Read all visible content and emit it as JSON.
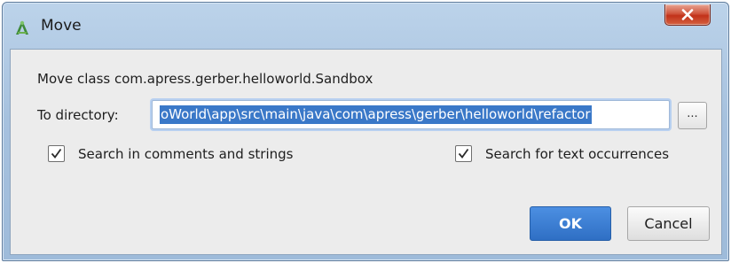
{
  "window": {
    "title": "Move",
    "icon": "android-studio-icon",
    "close_icon": "close-icon"
  },
  "dialog": {
    "move_label": "Move class com.apress.gerber.helloworld.Sandbox",
    "directory_label": "To directory:",
    "directory_value": "oWorld\\app\\src\\main\\java\\com\\apress\\gerber\\helloworld\\refactor",
    "browse_label": "...",
    "checkboxes": [
      {
        "label": "Search in comments and strings",
        "checked": true
      },
      {
        "label": "Search for text occurrences",
        "checked": true
      }
    ],
    "ok_label": "OK",
    "cancel_label": "Cancel"
  },
  "colors": {
    "accent": "#3a78c8",
    "ok_button": "#2f6fc4",
    "close_button": "#c2321a"
  }
}
